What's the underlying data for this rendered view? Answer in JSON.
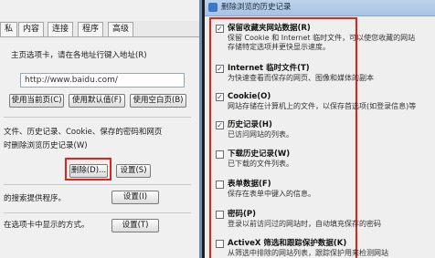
{
  "left": {
    "title_fragment": "",
    "tabs": [
      "私",
      "内容",
      "连接",
      "程序",
      "高级"
    ],
    "home_label_frag": "主页选项卡，请在各地址行键入地址(R)",
    "home_url": "http://www.baidu.com/",
    "btn_current": "使用当前页(C)",
    "btn_default": "使用默认值(F)",
    "btn_blank": "使用空白页(B)",
    "history_line1": "文件、历史记录、Cookie、保存的密码和网页",
    "history_line2": "时删除浏览历史记录(W)",
    "btn_delete": "删除(D)...",
    "btn_settings": "设置(S)",
    "search_frag": "的搜索提供程序。",
    "tabs_frag": "在选项卡中显示的方式。",
    "btn_settings2": "设置(I)",
    "btn_settings3": "设置(T)"
  },
  "right": {
    "title": "删除浏览的历史记录",
    "options": [
      {
        "checked": true,
        "title": "保留收藏夹网站数据(R)",
        "desc": [
          "保留 Cookie 和 Internet 临时文件，可以使您收藏的网站",
          "存储特定选项并更快显示速度。"
        ]
      },
      {
        "checked": true,
        "title": "Internet 临时文件(T)",
        "desc": [
          "为快速查看而保存的网页、图像和媒体的副本"
        ]
      },
      {
        "checked": true,
        "title": "Cookie(O)",
        "desc": [
          "网站存储在计算机上的文件，以保存首选项(如登录信息)等"
        ]
      },
      {
        "checked": true,
        "title": "历史记录(H)",
        "desc": [
          "已访问网站的列表。"
        ]
      },
      {
        "checked": false,
        "title": "下载历史记录(W)",
        "desc": [
          "已下载的文件列表。"
        ]
      },
      {
        "checked": false,
        "title": "表单数据(F)",
        "desc": [
          "保存在表单中键入的信息。"
        ]
      },
      {
        "checked": false,
        "title": "密码(P)",
        "desc": [
          "登录以前访问过的网站时，自动填充保存的密码"
        ]
      },
      {
        "checked": false,
        "title": "ActiveX 筛选和跟踪保护数据(K)",
        "desc": [
          "从筛选中排除的网站列表，跟踪保护用来检测网站"
        ]
      }
    ]
  }
}
